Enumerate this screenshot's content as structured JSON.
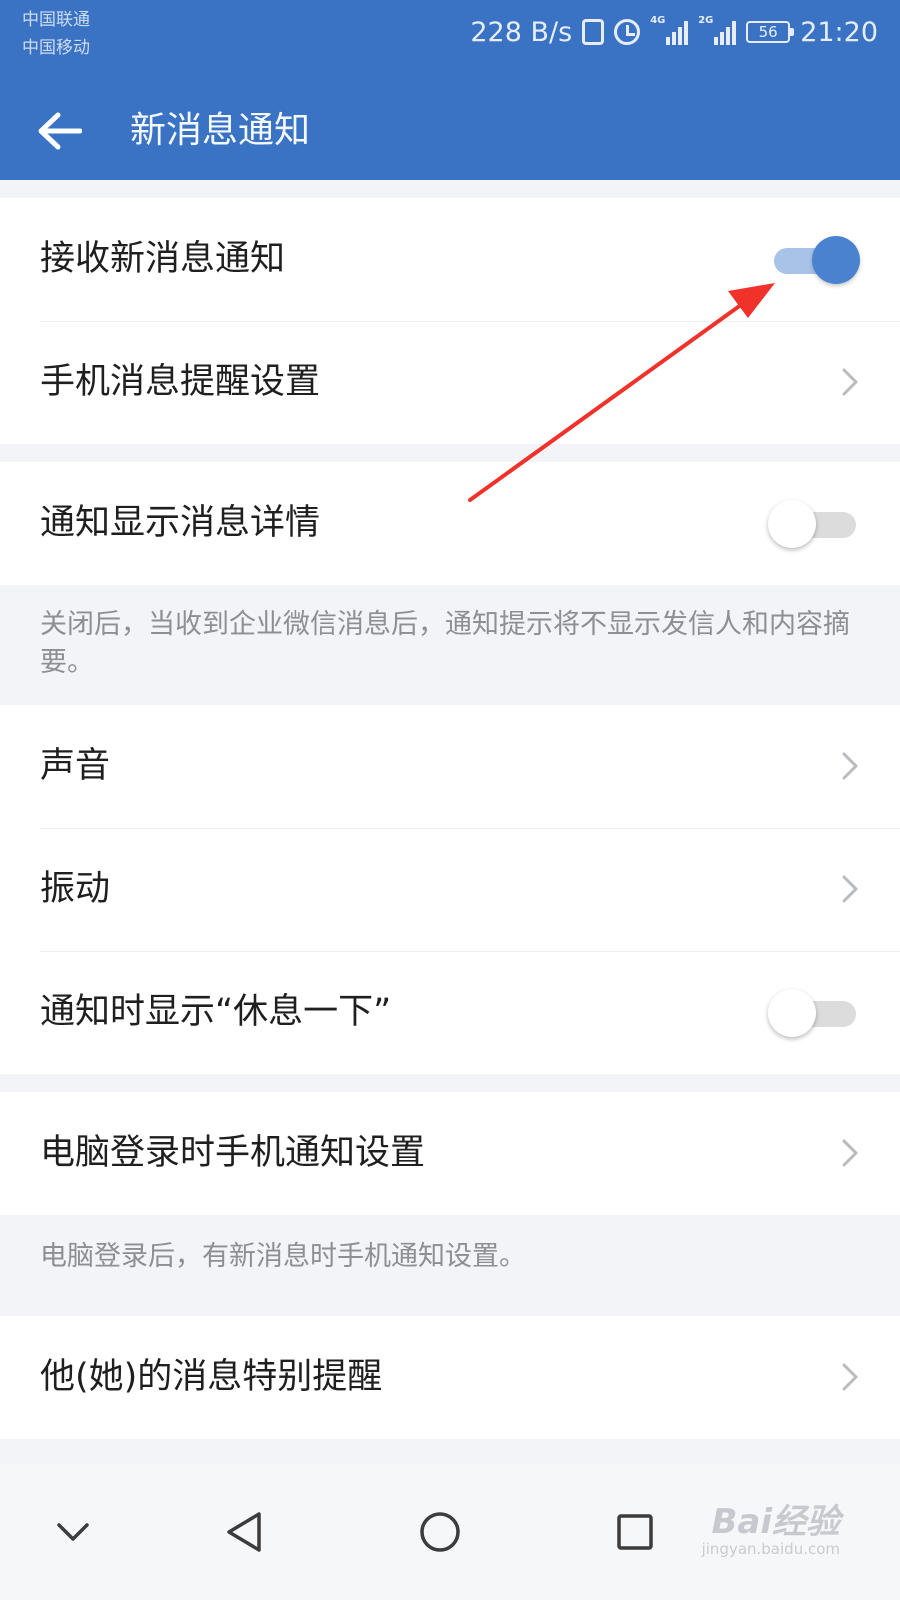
{
  "status_bar": {
    "carrier_1": "中国联通",
    "carrier_2": "中国移动",
    "network_speed": "228 B/s",
    "signal_1_type": "4G",
    "signal_2_type": "2G",
    "battery_level": "56",
    "time": "21:20"
  },
  "header": {
    "title": "新消息通知",
    "back_icon": "arrow-left-icon",
    "background_color": "#3b73c4"
  },
  "settings": {
    "group_1": {
      "receive_notifications": {
        "label": "接收新消息通知",
        "toggle": "on"
      },
      "phone_reminder": {
        "label": "手机消息提醒设置"
      }
    },
    "group_2": {
      "show_details": {
        "label": "通知显示消息详情",
        "toggle": "off"
      },
      "show_details_note": "关闭后，当收到企业微信消息后，通知提示将不显示发信人和内容摘要。"
    },
    "group_3": {
      "sound": {
        "label": "声音"
      },
      "vibration": {
        "label": "振动"
      },
      "show_break": {
        "label": "通知时显示“休息一下”",
        "toggle": "off"
      }
    },
    "group_4": {
      "pc_login": {
        "label": "电脑登录时手机通知设置"
      },
      "pc_login_note": "电脑登录后，有新消息时手机通知设置。"
    },
    "group_5": {
      "special_reminder": {
        "label": "他(她)的消息特别提醒"
      }
    }
  },
  "annotation": {
    "arrow_color": "#f0322a"
  },
  "nav_bar": {
    "buttons": [
      "chevron-down-icon",
      "back-triangle-icon",
      "home-circle-icon",
      "recents-square-icon"
    ]
  },
  "watermark": {
    "logo": "Bai经验",
    "url": "jingyan.baidu.com"
  }
}
